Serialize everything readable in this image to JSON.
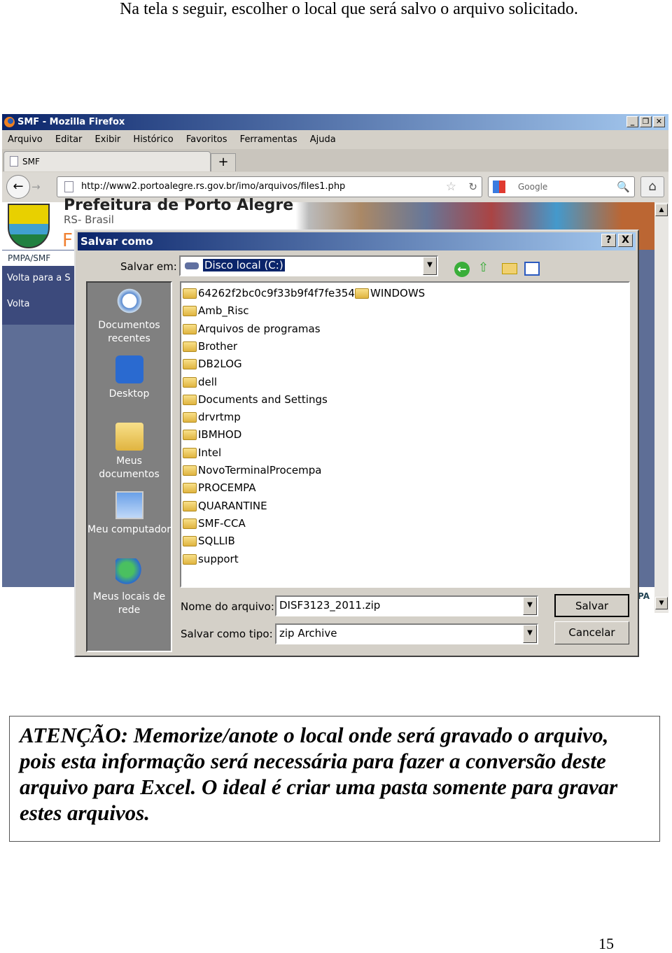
{
  "caption": "Na tela s seguir, escolher o local que será salvo o arquivo solicitado.",
  "browser": {
    "title": "SMF - Mozilla Firefox",
    "menu": [
      "Arquivo",
      "Editar",
      "Exibir",
      "Histórico",
      "Favoritos",
      "Ferramentas",
      "Ajuda"
    ],
    "tab_label": "SMF",
    "new_tab": "+",
    "url": "http://www2.portoalegre.rs.gov.br/imo/arquivos/files1.php",
    "search_placeholder": "Google",
    "page": {
      "org_name": "Prefeitura de Porto Alegre",
      "org_sub": "RS- Brasil",
      "breadcrumb": "PMPA/SMF",
      "nav_items": [
        "Volta para a S",
        "Volta"
      ],
      "right_fragment": "PA"
    }
  },
  "dialog": {
    "title": "Salvar como",
    "help": "?",
    "close": "X",
    "save_in_label": "Salvar em:",
    "save_in_value": "Disco local (C:)",
    "places": [
      "Documentos recentes",
      "Desktop",
      "Meus documentos",
      "Meu computador",
      "Meus locais de rede"
    ],
    "files_col1": [
      "64262f2bc0c9f33b9f4f7fe354",
      "Amb_Risc",
      "Arquivos de programas",
      "Brother",
      "DB2LOG",
      "dell",
      "Documents and Settings",
      "drvrtmp",
      "IBMHOD",
      "Intel",
      "NovoTerminalProcempa",
      "PROCEMPA",
      "QUARANTINE",
      "SMF-CCA",
      "SQLLIB",
      "support"
    ],
    "files_col2": [
      "WINDOWS"
    ],
    "filename_label": "Nome do arquivo:",
    "filename_value": "DISF3123_2011.zip",
    "type_label": "Salvar como tipo:",
    "type_value": "zip Archive",
    "save_button": "Salvar",
    "cancel_button": "Cancelar"
  },
  "note": "ATENÇÃO:  Memorize/anote o local onde será gravado o arquivo, pois esta informação será necessária para fazer a conversão deste arquivo para Excel.  O ideal é criar uma pasta somente para gravar estes arquivos.",
  "page_number": "15",
  "colors": {
    "titlebar": "#0a246a",
    "places_bar": "#808080",
    "page_bg": "#5e6e96"
  }
}
